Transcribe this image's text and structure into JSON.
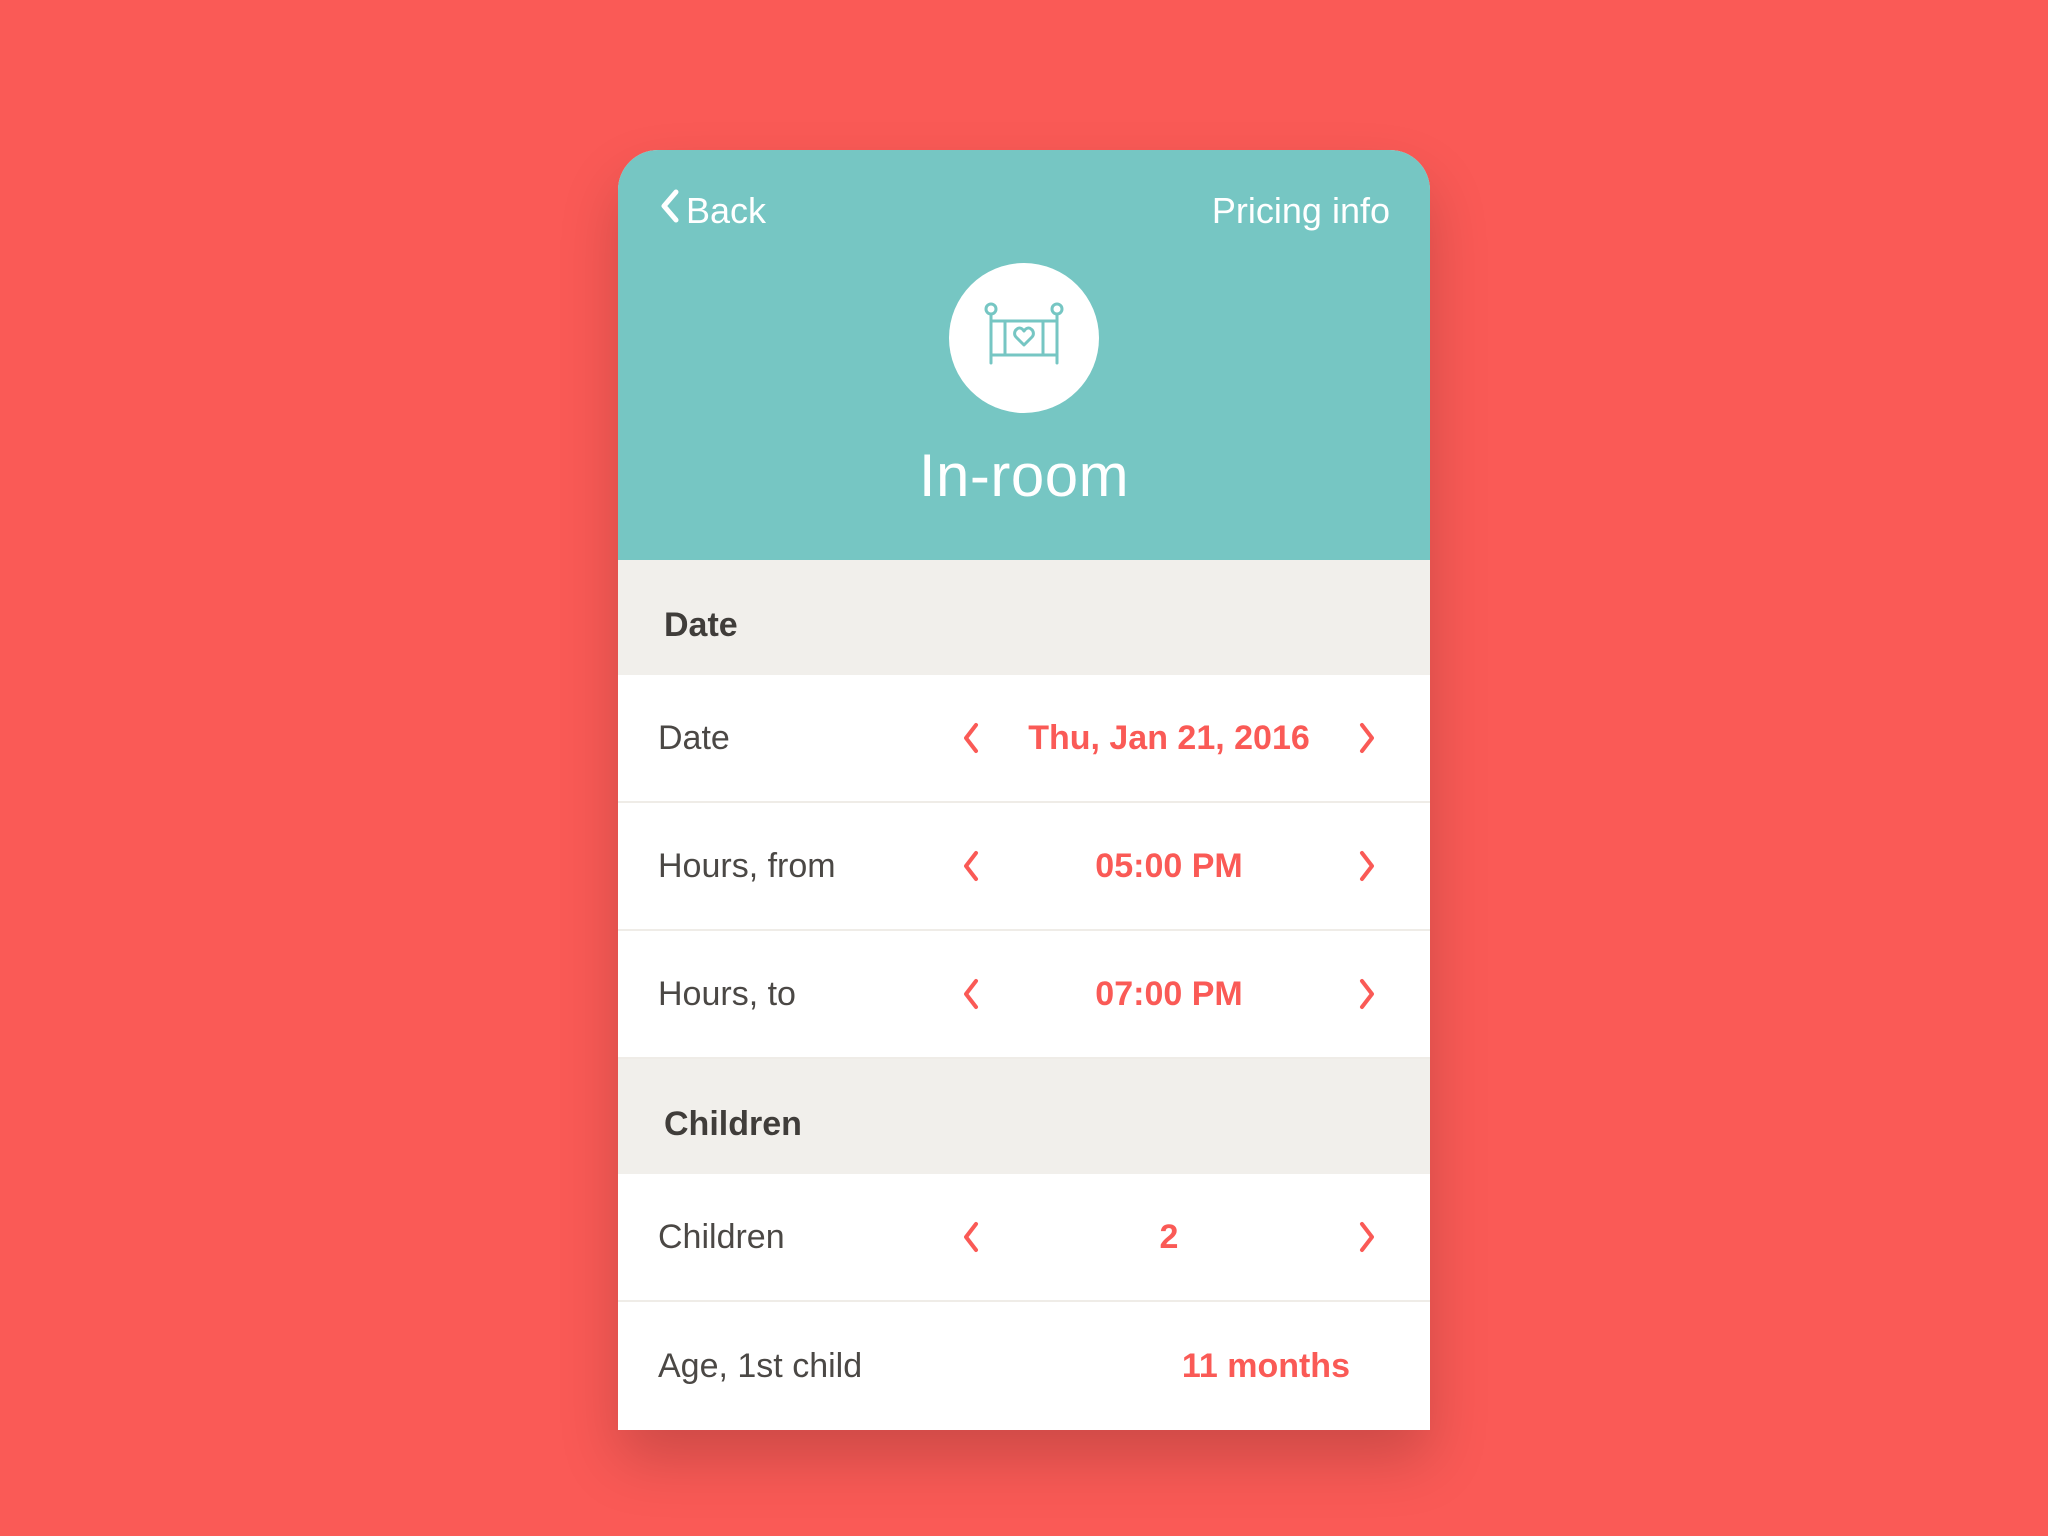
{
  "colors": {
    "accent": "#fa5a56",
    "header": "#76c6c3",
    "bg": "#f1efeb"
  },
  "nav": {
    "back_label": "Back",
    "right_link": "Pricing info"
  },
  "hero": {
    "title": "In-room",
    "icon": "crib-icon"
  },
  "sections": {
    "date": {
      "header": "Date",
      "rows": [
        {
          "label": "Date",
          "value": "Thu, Jan 21, 2016",
          "stepper": true
        },
        {
          "label": "Hours, from",
          "value": "05:00 PM",
          "stepper": true
        },
        {
          "label": "Hours, to",
          "value": "07:00 PM",
          "stepper": true
        }
      ]
    },
    "children": {
      "header": "Children",
      "rows": [
        {
          "label": "Children",
          "value": "2",
          "stepper": true
        },
        {
          "label": "Age, 1st child",
          "value": "11 months",
          "stepper": false
        }
      ]
    }
  }
}
